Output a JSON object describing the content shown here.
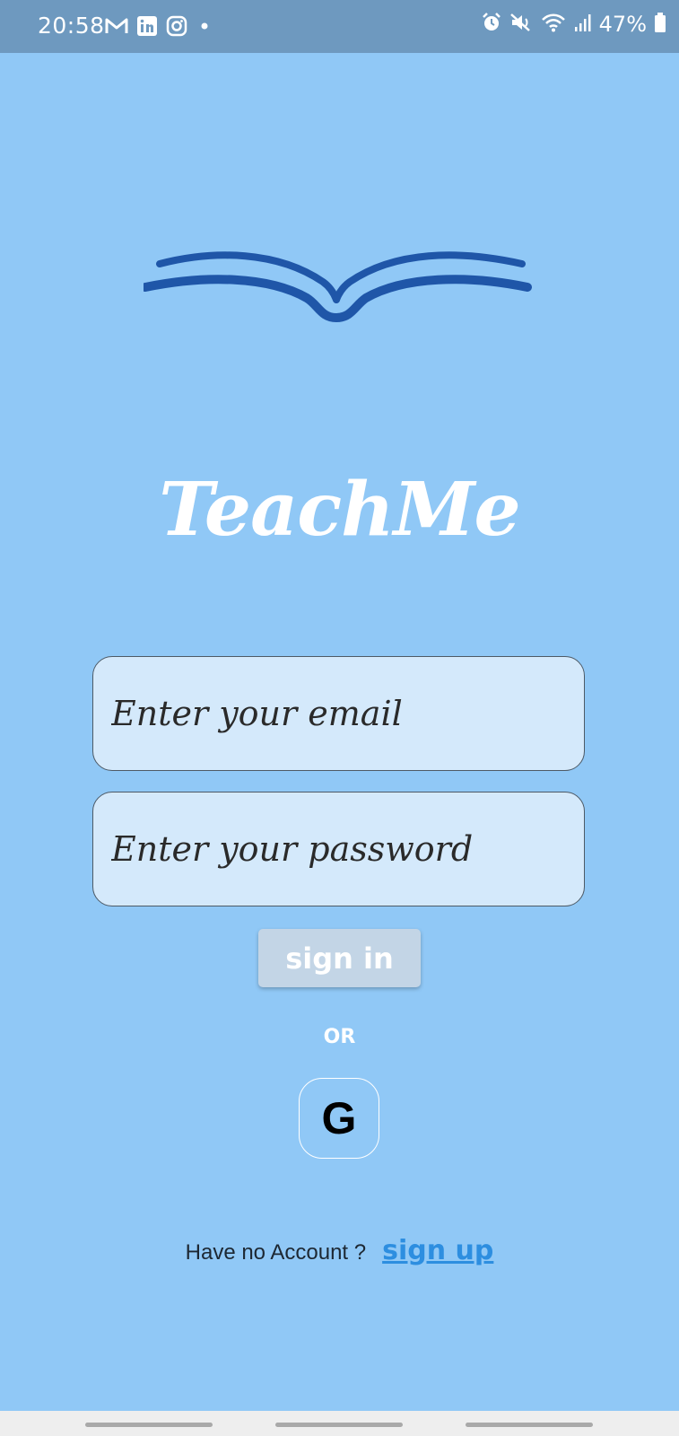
{
  "status_bar": {
    "time": "20:58",
    "left_icons": [
      "gmail-icon",
      "linkedin-icon",
      "instagram-icon",
      "dot-icon"
    ],
    "right_icons": [
      "alarm-icon",
      "mute-icon",
      "wifi-icon",
      "signal-icon",
      "battery-icon"
    ],
    "battery": "47%"
  },
  "app": {
    "logo_icon": "open-book-icon",
    "title": "TeachMe"
  },
  "form": {
    "email_placeholder": "Enter your email",
    "password_placeholder": "Enter your password",
    "signin_label": "sign in",
    "or_label": "OR",
    "google_label": "G"
  },
  "signup": {
    "prompt": "Have no Account ?",
    "link": "sign up"
  },
  "colors": {
    "background": "#90c8f6",
    "status_bar": "#6e99bf",
    "logo": "#1f56a8",
    "field_bg": "#d4e9fb",
    "link": "#2d8ee0"
  }
}
